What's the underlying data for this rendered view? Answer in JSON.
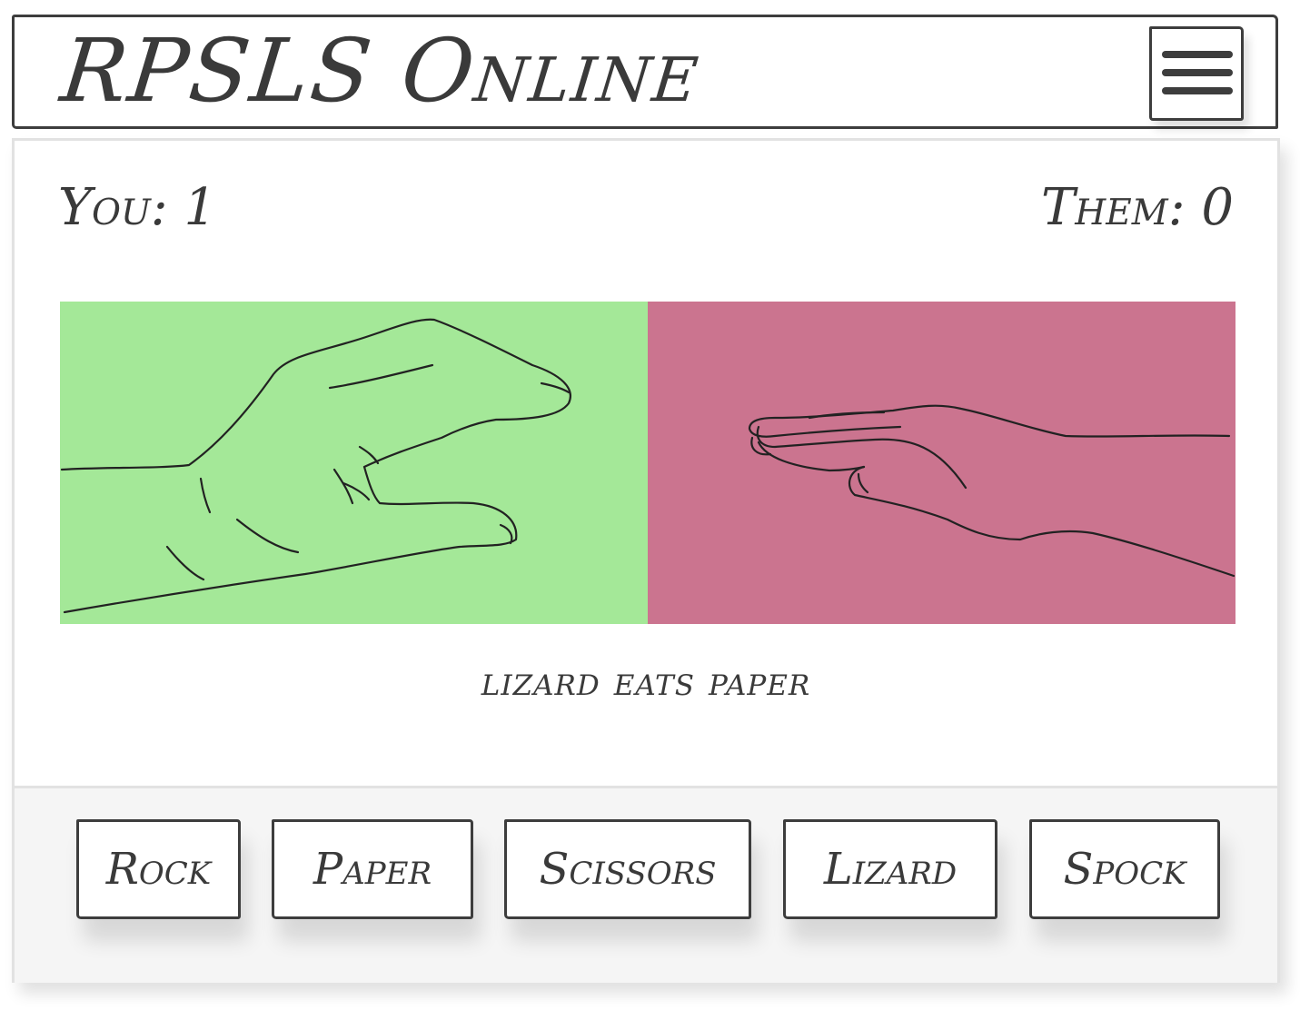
{
  "header": {
    "title": "RPSLS Online",
    "menu_icon": "hamburger-menu-icon"
  },
  "scores": {
    "you": "You: 1",
    "them": "Them: 0"
  },
  "hands": {
    "you": {
      "icon": "lizard-hand-icon",
      "color": "#a4e898"
    },
    "them": {
      "icon": "paper-hand-icon",
      "color": "#cb748f"
    }
  },
  "result": "lizard eats paper",
  "choices": [
    {
      "label": "Rock"
    },
    {
      "label": "Paper"
    },
    {
      "label": "Scissors"
    },
    {
      "label": "Lizard"
    },
    {
      "label": "Spock"
    }
  ]
}
